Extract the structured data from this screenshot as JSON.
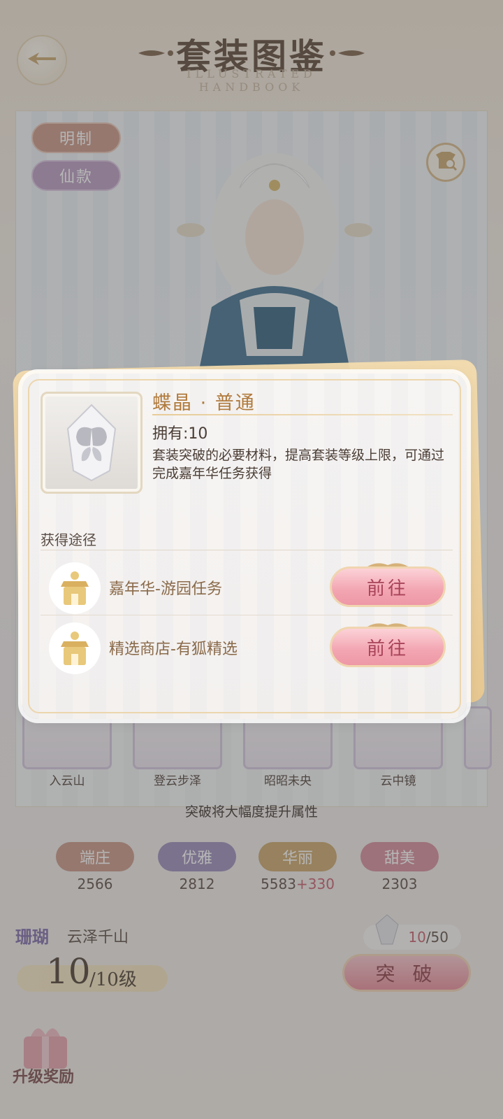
{
  "header": {
    "title": "套装图鉴",
    "subtitle": "ILLUSTRATED HANDBOOK"
  },
  "stage": {
    "tags": [
      "明制",
      "仙款"
    ],
    "thumbnails": [
      {
        "label": "入云山"
      },
      {
        "label": "登云步泽"
      },
      {
        "label": "昭昭未央"
      },
      {
        "label": "云中镜"
      }
    ]
  },
  "breakthrough_note": "突破将大幅度提升属性",
  "attributes": [
    {
      "name": "端庄",
      "value": "2566",
      "bonus": "",
      "color": "#c99583"
    },
    {
      "name": "优雅",
      "value": "2812",
      "bonus": "",
      "color": "#9a8ab8"
    },
    {
      "name": "华丽",
      "value": "5583",
      "bonus": "+330",
      "color": "#caa468"
    },
    {
      "name": "甜美",
      "value": "2303",
      "bonus": "",
      "color": "#d48b98"
    }
  ],
  "suit": {
    "rarity_tag": "珊瑚",
    "name": "云泽千山",
    "level": "10",
    "level_max": "/10级",
    "crystal_owned": "10",
    "crystal_need": "/50",
    "breakthrough_label": "突 破",
    "reward_label": "升级奖励"
  },
  "popup": {
    "item_name": "蝶晶 · 普通",
    "owned": "拥有:10",
    "description": "套装突破的必要材料，提高套装等级上限，可通过完成嘉年华任务获得",
    "source_title": "获得途径",
    "sources": [
      {
        "label": "嘉年华-游园任务",
        "button": "前往"
      },
      {
        "label": "精选商店-有狐精选",
        "button": "前往"
      }
    ]
  }
}
